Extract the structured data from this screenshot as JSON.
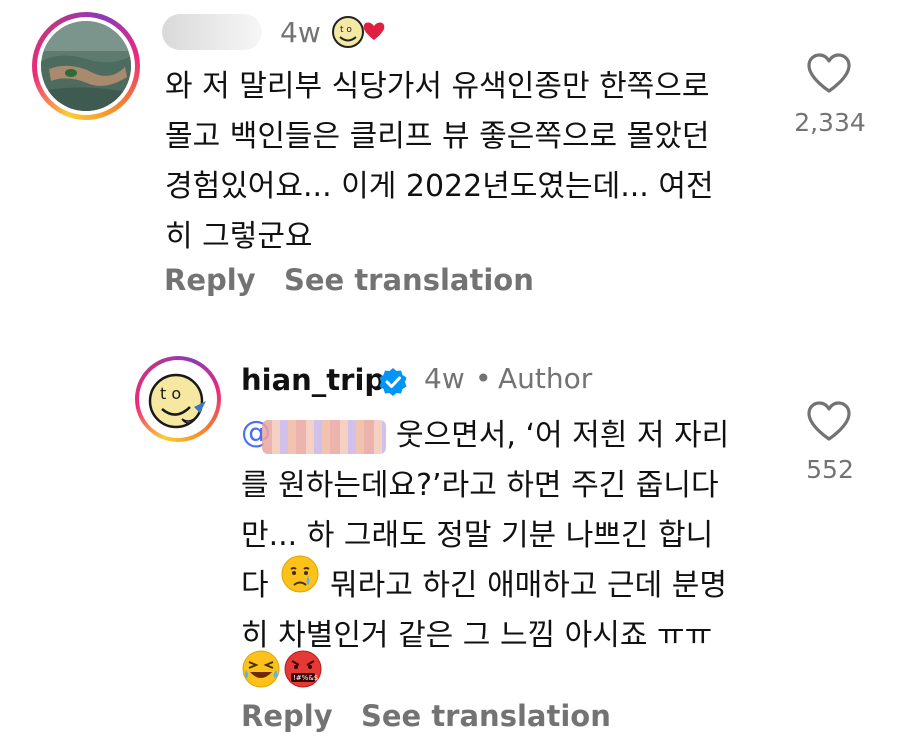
{
  "comment1": {
    "username": "",
    "time": "4w",
    "lines": [
      "와 저 말리부 식당가서 유색인종만 한쪽으로",
      "몰고 백인들은 클리프 뷰 좋은쪽으로 몰았던",
      "경험있어요... 이게 2022년도였는데... 여전",
      "히 그렇군요"
    ],
    "like_count": "2,334",
    "reply_label": "Reply",
    "translate_label": "See translation"
  },
  "comment2": {
    "username": "hian_trip",
    "time": "4w",
    "separator": "•",
    "author_badge": "Author",
    "mention": "@",
    "lines": [
      "웃으면서, ‘어 저흰 저 자리",
      "를 원하는데요?’라고 하면 주긴 줍니다",
      "만... 하 그래도 정말 기분 나쁘긴 합니",
      "다",
      "뭐라고 하긴 애매하고 근데 분명",
      "히 차별인거 같은 그 느낌 아시죠 ㅠㅠ"
    ],
    "emoji_end": "😂🤬",
    "like_count": "552",
    "reply_label": "Reply",
    "translate_label": "See translation"
  },
  "icons": {
    "heart": "heart-icon",
    "verified": "verified-badge-icon",
    "sad": "crying-face-icon",
    "hian_logo": "hian-trip-logo"
  },
  "colors": {
    "meta_gray": "#737373",
    "verified_blue": "#0095f6",
    "mention_blue": "#4a6cf7"
  }
}
